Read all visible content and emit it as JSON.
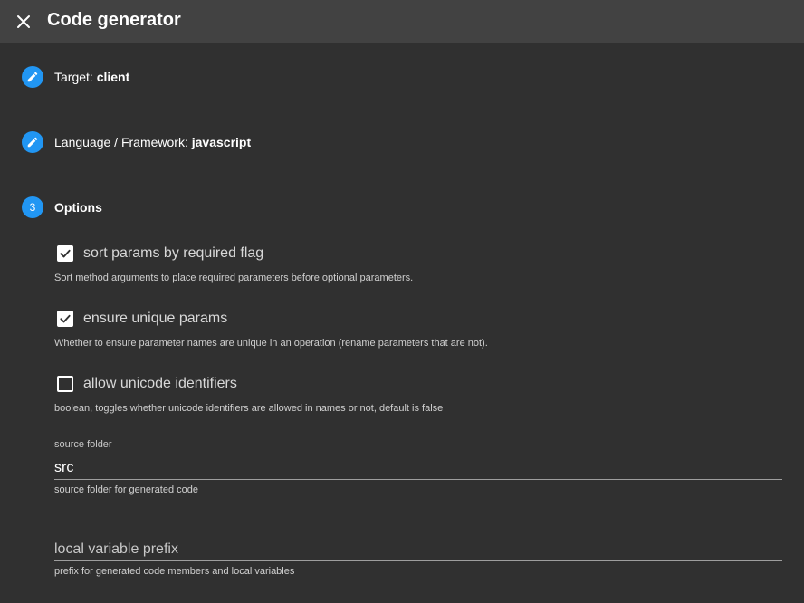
{
  "header": {
    "title": "Code generator",
    "close_icon": "close-icon"
  },
  "steps": [
    {
      "label": "Target: ",
      "value": "client",
      "icon": "pencil-icon"
    },
    {
      "label": "Language / Framework: ",
      "value": "javascript",
      "icon": "pencil-icon"
    },
    {
      "number": "3",
      "label": "Options"
    }
  ],
  "options": {
    "sort_params": {
      "label": "sort params by required flag",
      "checked": true,
      "hint": "Sort method arguments to place required parameters before optional parameters."
    },
    "unique_params": {
      "label": "ensure unique params",
      "checked": true,
      "hint": "Whether to ensure parameter names are unique in an operation (rename parameters that are not)."
    },
    "unicode_ids": {
      "label": "allow unicode identifiers",
      "checked": false,
      "hint": "boolean, toggles whether unicode identifiers are allowed in names or not, default is false"
    },
    "source_folder": {
      "label": "source folder",
      "value": "src",
      "hint": "source folder for generated code"
    },
    "local_var_prefix": {
      "placeholder": "local variable prefix",
      "value": "",
      "hint": "prefix for generated code members and local variables"
    }
  },
  "colors": {
    "accent": "#2196f3",
    "background": "#303030",
    "header": "#424242"
  }
}
